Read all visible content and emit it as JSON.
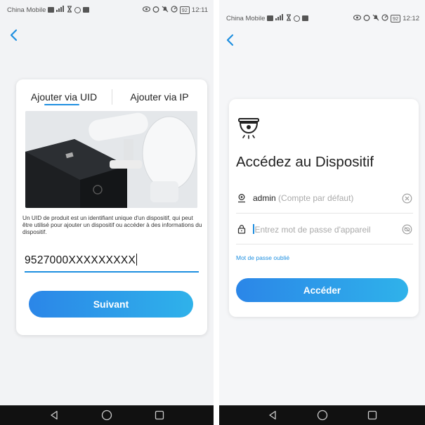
{
  "left_screen": {
    "status_bar": {
      "carrier": "China Mobile",
      "battery": "92",
      "time": "12:11"
    },
    "tabs": [
      {
        "label": "Ajouter via UID",
        "active": true
      },
      {
        "label": "Ajouter via IP",
        "active": false
      }
    ],
    "description": "Un UID de produit est un identifiant unique d'un dispositif, qui peut être utilisé pour ajouter un dispositif ou accéder à des informations du dispositif.",
    "uid_input": {
      "value": "9527000XXXXXXXXX"
    },
    "next_button": {
      "label": "Suivant"
    }
  },
  "right_screen": {
    "status_bar": {
      "carrier": "China Mobile",
      "battery": "92",
      "time": "12:12"
    },
    "title": "Accédez au Dispositif",
    "account_field": {
      "value": "admin",
      "hint": "(Compte par défaut)"
    },
    "password_field": {
      "placeholder": "Entrez mot de passe d'appareil"
    },
    "forgot_link": "Mot de passe oublié",
    "submit_button": {
      "label": "Accéder"
    }
  },
  "theme": {
    "accent": "#1e8fe0",
    "button_gradient_start": "#2b86e8",
    "button_gradient_end": "#2fb2ea",
    "navbar": "#111111"
  },
  "icons": {
    "back": "chevron-left-icon",
    "camera": "dome-camera-icon",
    "account": "user-location-icon",
    "lock": "lock-icon",
    "clear": "clear-circle-icon",
    "eye_off": "eye-off-icon",
    "nav_back": "triangle-back-icon",
    "nav_home": "circle-home-icon",
    "nav_recents": "square-recents-icon"
  }
}
